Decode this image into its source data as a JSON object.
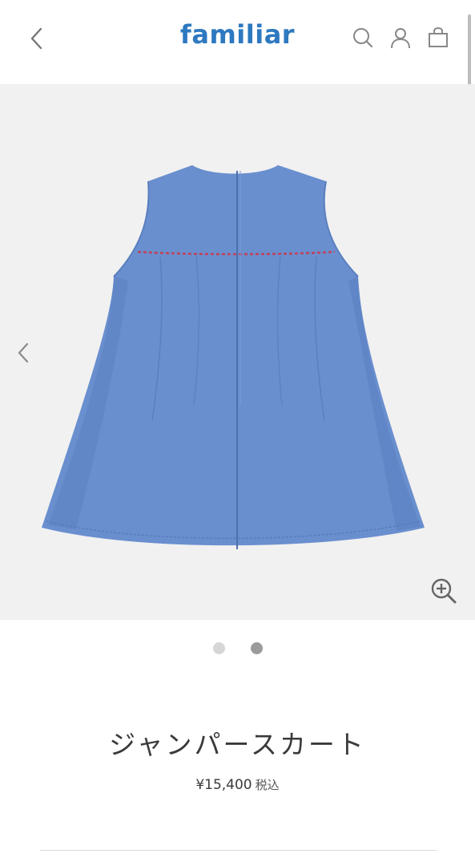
{
  "header": {
    "logo": "familiar",
    "back_icon": "chevron-left-icon",
    "icons": [
      "search-icon",
      "user-icon",
      "bag-icon"
    ]
  },
  "gallery": {
    "prev_icon": "chevron-left-icon",
    "zoom_icon": "zoom-in-icon",
    "slides": 2,
    "active_slide": 2,
    "product_image": "blue sleeveless dress back view"
  },
  "product": {
    "title": "ジャンパースカート",
    "price": "¥15,400",
    "tax_label": "税込"
  },
  "colors": {
    "brand": "#2e79c0",
    "dress": "#6a8fcf",
    "gallery_bg": "#f1f1f1"
  }
}
